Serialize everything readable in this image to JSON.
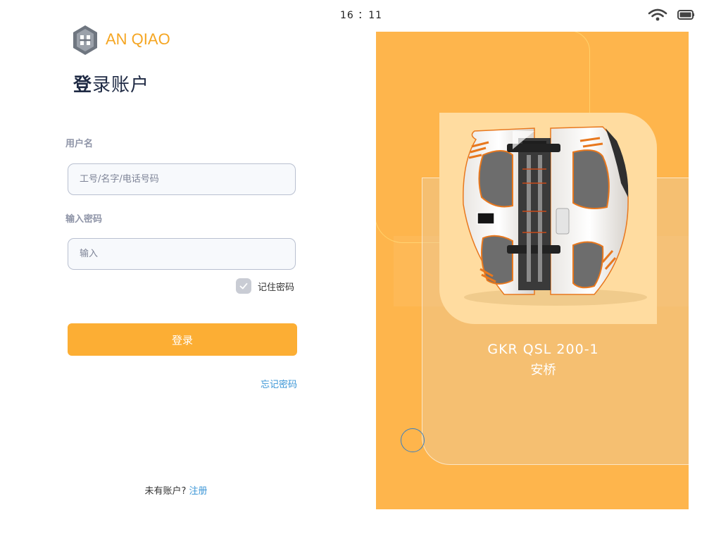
{
  "status_bar": {
    "time": "16 ：11"
  },
  "brand": {
    "name": "AN QIAO"
  },
  "page": {
    "title_bold": "登",
    "title_rest": "录账户"
  },
  "form": {
    "username_label": "用户名",
    "username_placeholder": "工号/名字/电话号码",
    "password_label": "输入密码",
    "password_placeholder": "输入",
    "remember_label": "记住密码",
    "remember_checked": true,
    "login_label": "登录",
    "forgot_label": "忘记密码"
  },
  "footer": {
    "no_account": "未有账户?",
    "register": "注册"
  },
  "product": {
    "name": "GKR QSL 200-1",
    "brand": "安桥"
  },
  "colors": {
    "accent": "#fcae34",
    "panel": "#feb54c",
    "link": "#3a95d6",
    "title": "#1f2a44"
  },
  "icons": [
    "wifi-icon",
    "battery-icon",
    "logo-icon",
    "check-icon",
    "robot-image"
  ]
}
